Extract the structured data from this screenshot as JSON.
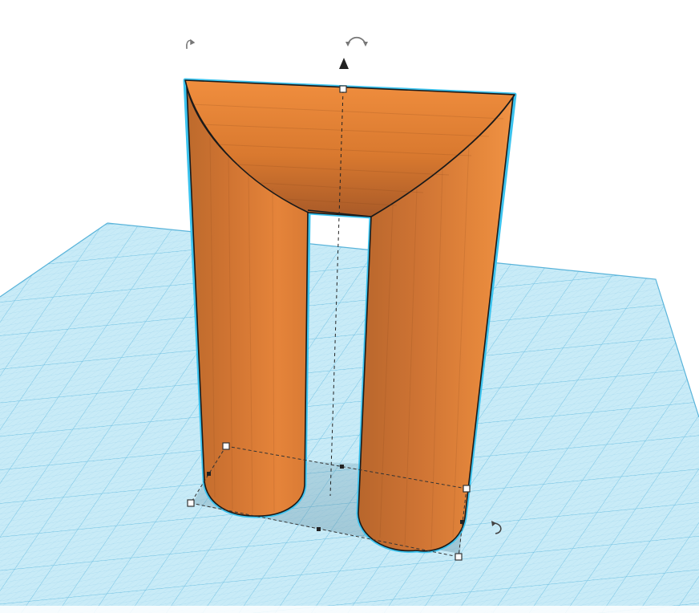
{
  "app": {
    "view": "3d-workplane"
  },
  "colors": {
    "background": "#ffffff",
    "workplane": "#bfe6f5",
    "grid_minor": "#9fd3ea",
    "grid_major": "#62b8dc",
    "shape_light": "#ee8c3c",
    "shape_mid": "#d97730",
    "shape_dark": "#b5622a",
    "selection_outline": "#3cc3ee",
    "edge": "#1a1a1a"
  },
  "scene": {
    "shape": {
      "kind": "arch-with-two-legs",
      "selected": true,
      "color_name": "orange"
    },
    "handles": {
      "rotate_left_icon": "rotate-arc-icon",
      "rotate_top_icon": "rotate-curved-arrows-icon",
      "rotate_bottom_right_icon": "rotate-ccw-icon",
      "lift_icon": "up-arrow-icon"
    }
  }
}
